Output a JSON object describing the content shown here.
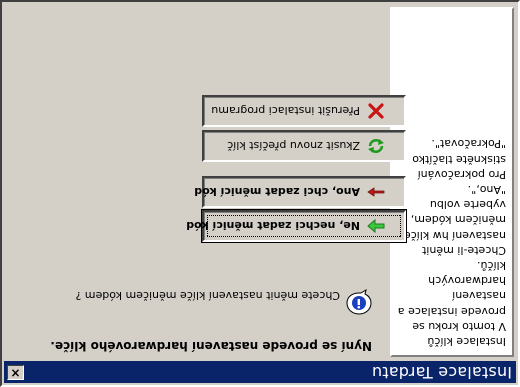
{
  "window": {
    "title": "Instalace Tardatu",
    "close_label": "×"
  },
  "sidebar": {
    "text": "Instalace klíčů\nV tomto kroku se\nprovede instalace a\nnastavení hardwarových\nklíčů.\nChcete-li měnit\nnastavení hw klíče\nměničem kódem,\nvyberte volbu \"Ano,\".\nPro pokračování\nstiskněte tlačítko\n\"Pokračovat\"."
  },
  "main": {
    "heading": "Nyní se provede nastavení hardwarového klíče.",
    "question": "Chcete měnit nastavení klíče měničem kódem ?",
    "buttons": [
      {
        "label": "Ne, nechci zadat měnicí kód",
        "icon": "green-arrow-icon"
      },
      {
        "label": "Ano, chci zadat měnicí kód",
        "icon": "red-arrow-icon"
      },
      {
        "label": "Zkusit znovu přečíst klíč",
        "icon": "refresh-icon"
      },
      {
        "label": "Přerušit instalaci programu",
        "icon": "red-x-icon"
      }
    ]
  },
  "colors": {
    "titlebar": "#0a246a",
    "face": "#d4d0c8"
  }
}
